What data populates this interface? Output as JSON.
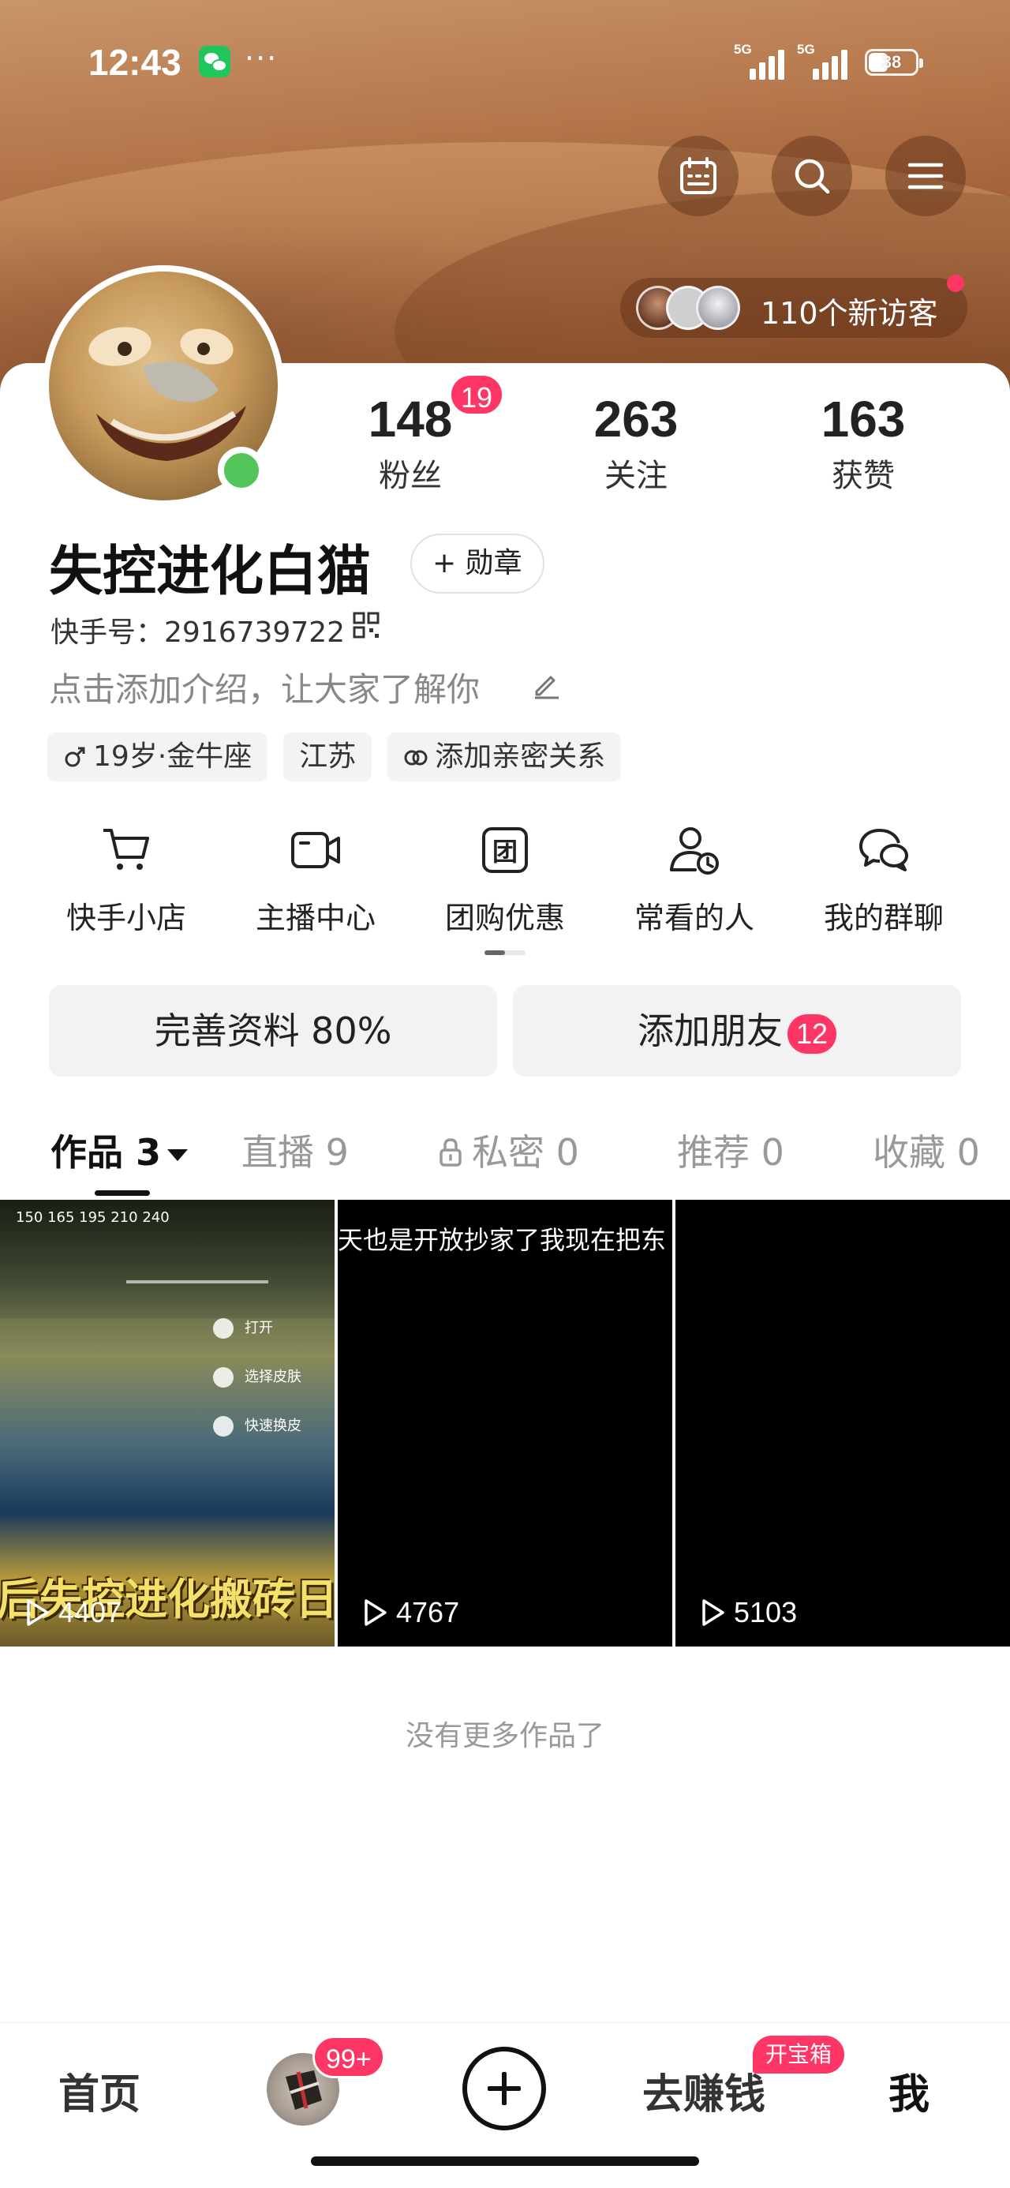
{
  "status_bar": {
    "time": "12:43",
    "more": "···",
    "signal1_label": "5G",
    "signal2_label": "5G",
    "battery": "38"
  },
  "header": {
    "visitors_text": "110个新访客",
    "icons": [
      "calendar-icon",
      "search-icon",
      "menu-icon"
    ]
  },
  "profile": {
    "stats": [
      {
        "num": "148",
        "label": "粉丝",
        "badge": "19"
      },
      {
        "num": "263",
        "label": "关注"
      },
      {
        "num": "163",
        "label": "获赞"
      }
    ],
    "username": "失控进化白猫",
    "medal_button": "+ 勋章",
    "kuaishou_id": "快手号：2916739722",
    "intro_placeholder": "点击添加介绍，让大家了解你",
    "tags": {
      "age": "19岁·金牛座",
      "location": "江苏",
      "relation": "添加亲密关系"
    }
  },
  "shortcuts": [
    {
      "label": "快手小店",
      "icon": "cart-icon"
    },
    {
      "label": "主播中心",
      "icon": "video-camera-icon"
    },
    {
      "label": "团购优惠",
      "icon": "group-buy-icon"
    },
    {
      "label": "常看的人",
      "icon": "person-clock-icon"
    },
    {
      "label": "我的群聊",
      "icon": "group-chat-icon"
    }
  ],
  "actions": {
    "complete_profile": "完善资料 80%",
    "add_friends": "添加朋友",
    "add_friends_badge": "12"
  },
  "tabs": {
    "works": "作品 3",
    "live": "直播 9",
    "private": "私密 0",
    "recommend": "推荐 0",
    "favorites": "收藏 0"
  },
  "videos": [
    {
      "plays": "4407",
      "caption": "后失控进化搬砖日",
      "menu": [
        "打开",
        "选择皮肤",
        "快速换皮"
      ],
      "hud": "150  165  195  210  240"
    },
    {
      "plays": "4767",
      "overlay": "天也是开放抄家了我现在把东"
    },
    {
      "plays": "5103"
    }
  ],
  "list_end": "没有更多作品了",
  "bottom_nav": {
    "home": "首页",
    "avatar_badge": "99+",
    "earn": "去赚钱",
    "earn_badge": "开宝箱",
    "me": "我"
  },
  "colors": {
    "accent": "#fe3666",
    "online": "#52c55b",
    "banner": "#a7653d"
  }
}
